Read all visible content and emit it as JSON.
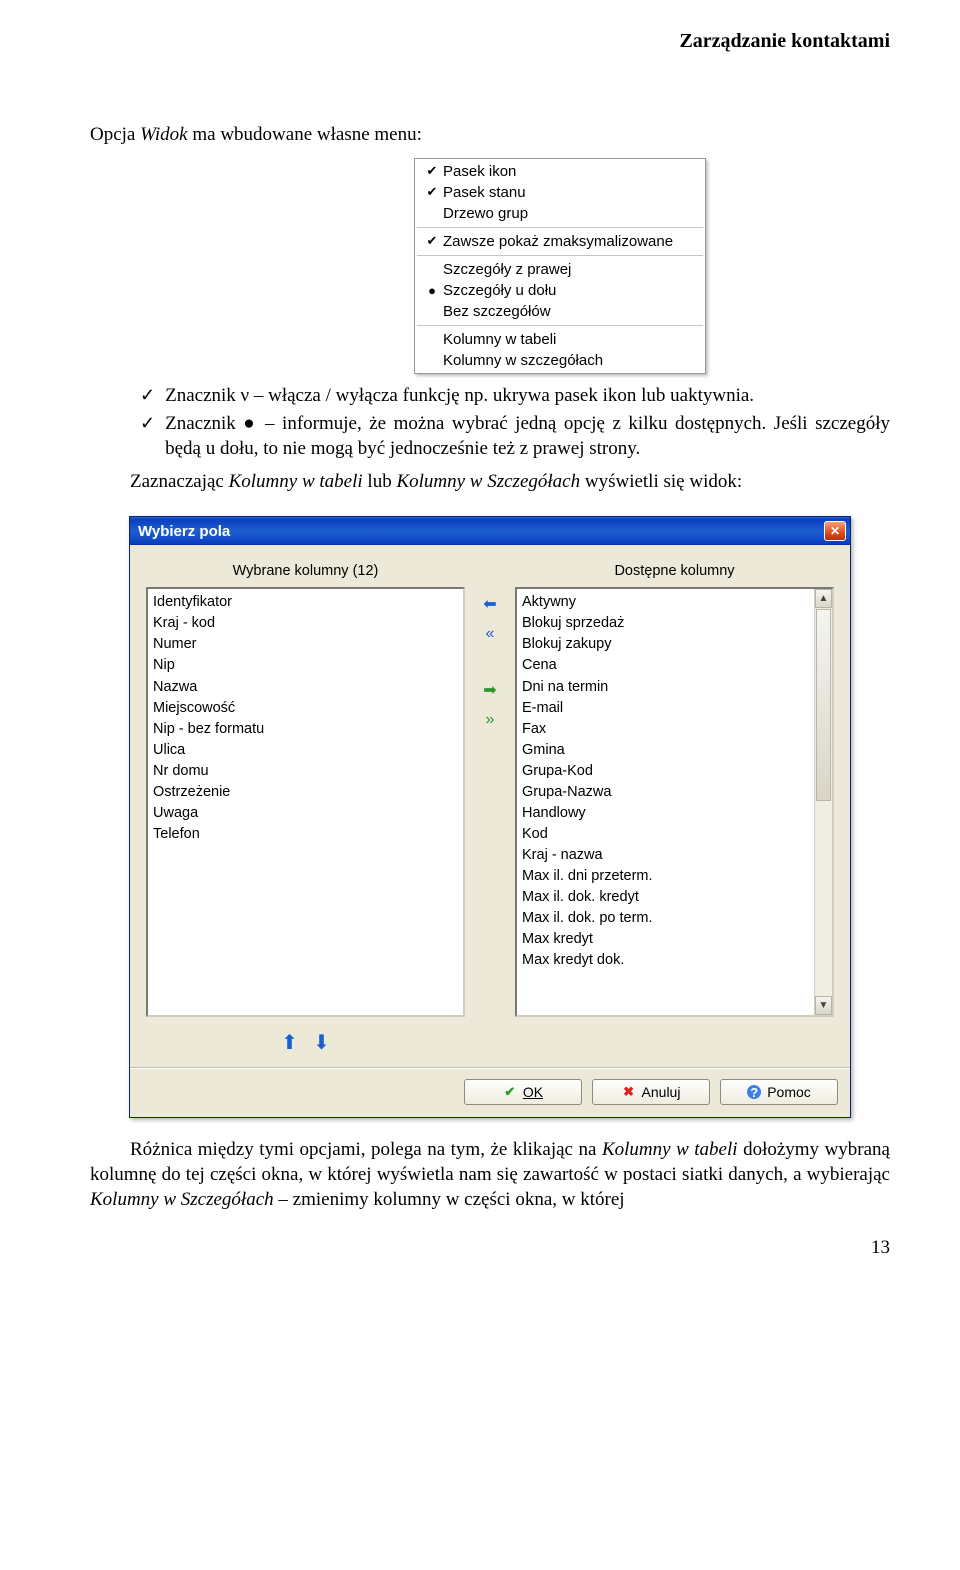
{
  "header": "Zarządzanie kontaktami",
  "intro": "Opcja Widok ma wbudowane własne menu:",
  "menu": {
    "items": [
      {
        "label": "Pasek ikon",
        "mark": "check"
      },
      {
        "label": "Pasek stanu",
        "mark": "check"
      },
      {
        "label": "Drzewo grup",
        "mark": ""
      },
      "sep",
      {
        "label": "Zawsze pokaż zmaksymalizowane",
        "mark": "check"
      },
      "sep",
      {
        "label": "Szczegóły z prawej",
        "mark": ""
      },
      {
        "label": "Szczegóły u dołu",
        "mark": "dot"
      },
      {
        "label": "Bez szczegółów",
        "mark": ""
      },
      "sep",
      {
        "label": "Kolumny w tabeli",
        "mark": ""
      },
      {
        "label": "Kolumny w szczegółach",
        "mark": ""
      }
    ]
  },
  "bullets": [
    "Znacznik ν – włącza / wyłącza funkcję  np. ukrywa pasek ikon lub uaktywnia.",
    "Znacznik ● – informuje, że można wybrać jedną opcję z kilku dostępnych. Jeśli szczegóły będą u dołu, to nie mogą być jednocześnie też z prawej strony."
  ],
  "para_after_bullets": "Zaznaczając Kolumny w tabeli lub Kolumny w Szczegółach wyświetli się widok:",
  "dialog": {
    "title": "Wybierz pola",
    "left_header": "Wybrane kolumny (12)",
    "right_header": "Dostępne kolumny",
    "left_items": [
      "Identyfikator",
      "Kraj - kod",
      "Numer",
      "Nip",
      "Nazwa",
      "Miejscowość",
      "Nip - bez formatu",
      "Ulica",
      "Nr domu",
      "Ostrzeżenie",
      "Uwaga",
      "Telefon"
    ],
    "right_items": [
      "Aktywny",
      "Blokuj sprzedaż",
      "Blokuj zakupy",
      "Cena",
      "Dni na termin",
      "E-mail",
      "Fax",
      "Gmina",
      "Grupa-Kod",
      "Grupa-Nazwa",
      "Handlowy",
      "Kod",
      "Kraj - nazwa",
      "Max il. dni przeterm.",
      "Max il. dok. kredyt",
      "Max il. dok. po term.",
      "Max kredyt",
      "Max kredyt dok."
    ],
    "buttons": {
      "ok": "OK",
      "cancel": "Anuluj",
      "help": "Pomoc"
    }
  },
  "para_bottom": "Różnica między tymi opcjami, polega na tym, że klikając na Kolumny w tabeli dołożymy wybraną kolumnę do tej części okna, w której wyświetla nam się zawartość w postaci siatki danych, a wybierając Kolumny w Szczegółach – zmienimy kolumny w części okna, w której",
  "page_number": "13"
}
